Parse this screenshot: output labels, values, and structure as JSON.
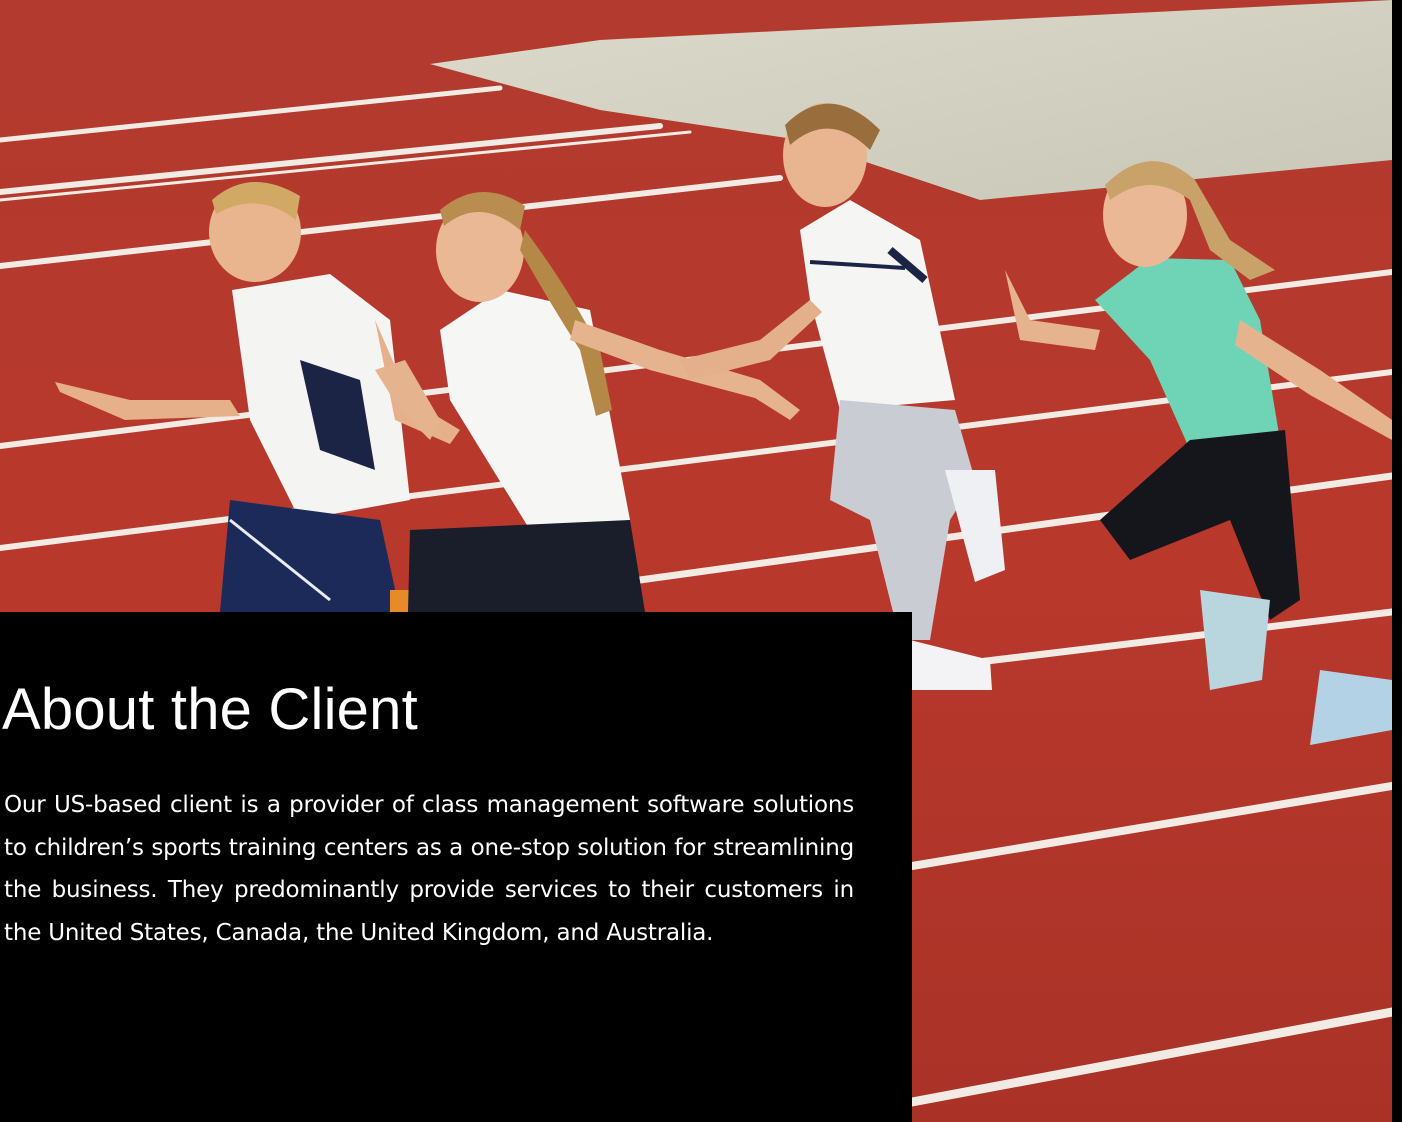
{
  "about": {
    "title": "About the Client",
    "body": "Our US-based client is a provider of class management software solutions to children’s sports training centers as a one-stop solution for streamlining the business. They predominantly provide services to their customers in the United States, Canada, the United Kingdom, and Australia."
  },
  "hero": {
    "description_icon": "photo-kids-running-on-track",
    "colors": {
      "track": "#b8372c",
      "lane_line": "#f2ece6",
      "infield": "#d4d2c4",
      "background": "#000000"
    }
  }
}
